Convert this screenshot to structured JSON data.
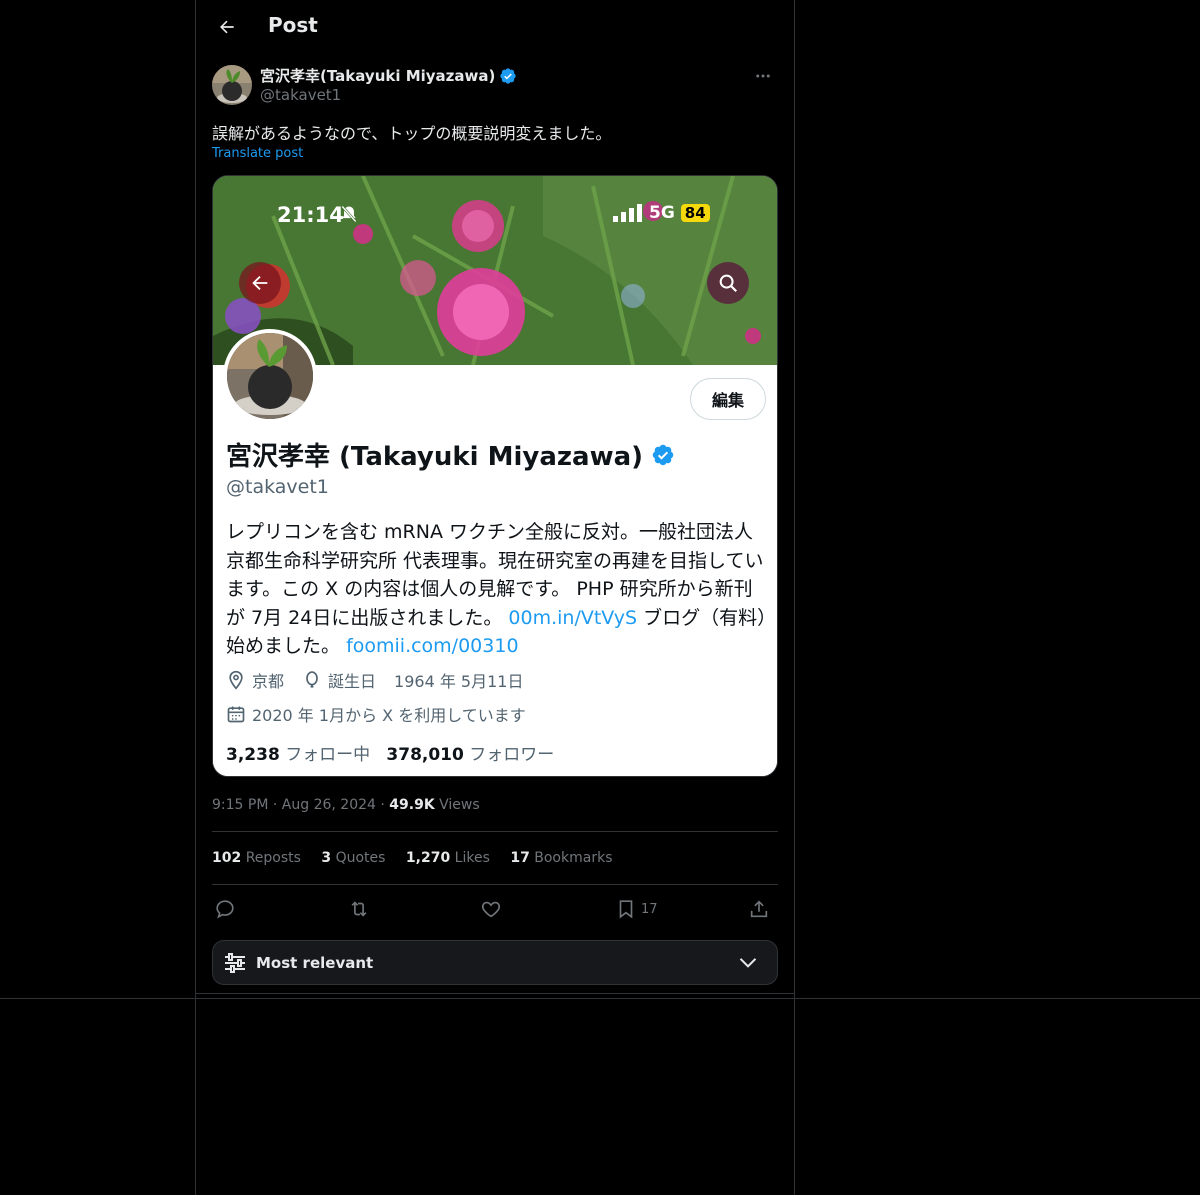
{
  "header": {
    "title": "Post"
  },
  "post": {
    "author_name": "宮沢孝幸(Takayuki Miyazawa)",
    "author_handle": "@takavet1",
    "text": "誤解があるようなので、トップの概要説明変えました。",
    "translate_label": "Translate post",
    "time": "9:15 PM",
    "date": "Aug 26, 2024",
    "views_count": "49.9K",
    "views_label": "Views",
    "stats": {
      "reposts_count": "102",
      "reposts_label": "Reposts",
      "quotes_count": "3",
      "quotes_label": "Quotes",
      "likes_count": "1,270",
      "likes_label": "Likes",
      "bookmarks_count": "17",
      "bookmarks_label": "Bookmarks"
    },
    "bookmark_action_count": "17"
  },
  "media": {
    "phone_time": "21:14",
    "network": "5G",
    "battery": "84",
    "edit_label": "編集",
    "profile_name": "宮沢孝幸 (Takayuki Miyazawa)",
    "profile_handle": "@takavet1",
    "bio_part1": "レプリコンを含む mRNA ワクチン全般に反対。一般社団法人京都生命科学研究所 代表理事。現在研究室の再建を目指しています。この X の内容は個人の見解です。 PHP 研究所から新刊が 7月 24日に出版されました。",
    "bio_link1": "00m.in/VtVyS",
    "bio_part2": "ブログ（有料）始めました。",
    "bio_link2": "foomii.com/00310",
    "location": "京都",
    "birthday_label": "誕生日",
    "birthday": "1964 年 5月11日",
    "joined": "2020 年 1月から X を利用しています",
    "following_count": "3,238",
    "following_label": "フォロー中",
    "followers_count": "378,010",
    "followers_label": "フォロワー"
  },
  "sort": {
    "label": "Most relevant"
  },
  "colors": {
    "accent": "#1d9bf0",
    "background": "#000000",
    "border": "#2f3336",
    "muted": "#71767b"
  }
}
